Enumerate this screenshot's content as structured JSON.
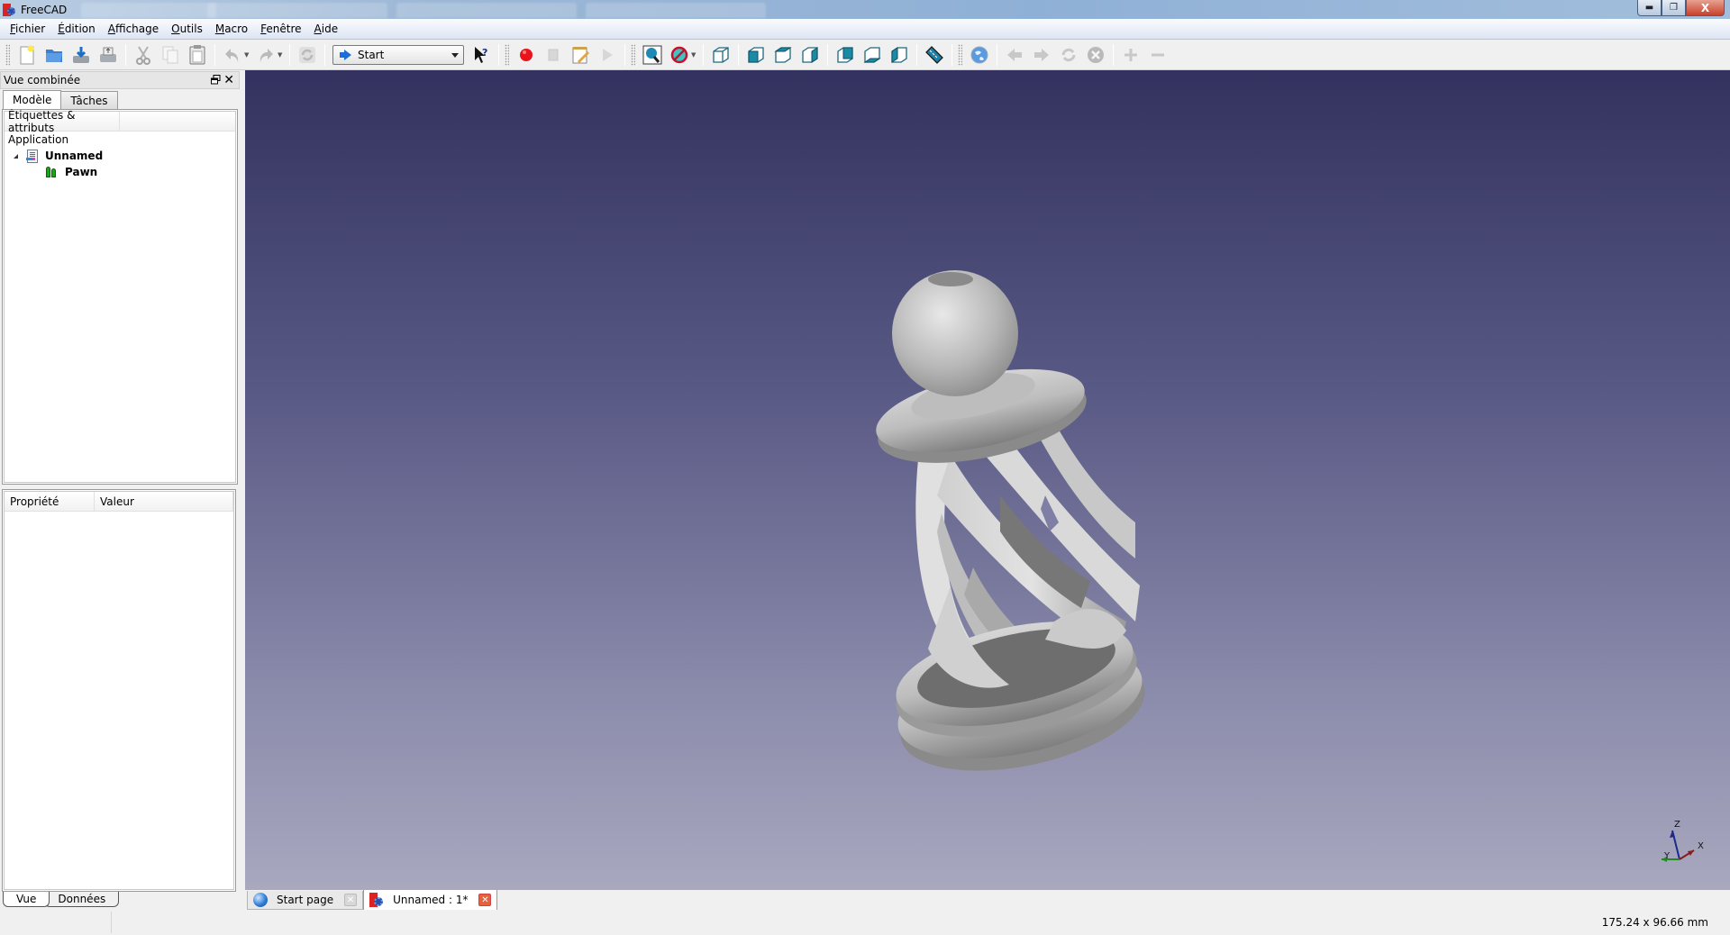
{
  "window": {
    "title": "FreeCAD",
    "controls": {
      "minimize": "—",
      "restore": "❐",
      "close": "X"
    }
  },
  "menubar": {
    "items": [
      {
        "label": "Fichier",
        "mnemonic": "F"
      },
      {
        "label": "Édition",
        "mnemonic": "É"
      },
      {
        "label": "Affichage",
        "mnemonic": "A"
      },
      {
        "label": "Outils",
        "mnemonic": "O"
      },
      {
        "label": "Macro",
        "mnemonic": "M"
      },
      {
        "label": "Fenêtre",
        "mnemonic": "F"
      },
      {
        "label": "Aide",
        "mnemonic": "A"
      }
    ]
  },
  "toolbar": {
    "file_tools": [
      {
        "icon": "new-document-icon",
        "enabled": true
      },
      {
        "icon": "open-folder-icon",
        "enabled": true
      },
      {
        "icon": "save-icon",
        "enabled": true
      },
      {
        "icon": "print-icon",
        "enabled": true
      }
    ],
    "edit_tools": [
      {
        "icon": "cut-icon",
        "enabled": false
      },
      {
        "icon": "copy-icon",
        "enabled": false
      },
      {
        "icon": "paste-icon",
        "enabled": true
      }
    ],
    "history_tools": [
      {
        "icon": "undo-icon",
        "enabled": false
      },
      {
        "icon": "redo-icon",
        "enabled": false
      },
      {
        "icon": "refresh-icon",
        "enabled": false
      }
    ],
    "workbench_selector": {
      "selected": "Start"
    },
    "whats_this_icon": "whats-this-icon",
    "macro_tools": [
      {
        "icon": "record-macro-icon",
        "enabled": true
      },
      {
        "icon": "stop-macro-icon",
        "enabled": false
      },
      {
        "icon": "edit-macro-icon",
        "enabled": true
      },
      {
        "icon": "run-macro-icon",
        "enabled": false
      }
    ],
    "view_tools": [
      {
        "icon": "fit-all-icon"
      },
      {
        "icon": "draw-style-icon"
      },
      {
        "icon": "isometric-view-icon"
      },
      {
        "icon": "front-view-icon"
      },
      {
        "icon": "top-view-icon"
      },
      {
        "icon": "right-view-icon"
      },
      {
        "icon": "rear-view-icon"
      },
      {
        "icon": "bottom-view-icon"
      },
      {
        "icon": "left-view-icon"
      },
      {
        "icon": "measure-distance-icon"
      }
    ],
    "web_tools": [
      {
        "icon": "web-globe-icon",
        "enabled": true
      },
      {
        "icon": "back-arrow-icon",
        "enabled": false
      },
      {
        "icon": "forward-arrow-icon",
        "enabled": false
      },
      {
        "icon": "web-refresh-icon",
        "enabled": false
      },
      {
        "icon": "web-stop-icon",
        "enabled": false
      },
      {
        "icon": "zoom-in-icon",
        "enabled": false
      },
      {
        "icon": "zoom-out-icon",
        "enabled": false
      }
    ]
  },
  "combo_view": {
    "title": "Vue combinée",
    "tabs": [
      {
        "label": "Modèle",
        "active": true
      },
      {
        "label": "Tâches",
        "active": false
      }
    ],
    "tree": {
      "header": "Étiquettes & attributs",
      "root": "Application",
      "document": "Unnamed",
      "objects": [
        {
          "label": "Pawn"
        }
      ]
    },
    "properties": {
      "columns": [
        "Propriété",
        "Valeur"
      ],
      "tabs": [
        {
          "label": "Vue",
          "active": true
        },
        {
          "label": "Données",
          "active": false
        }
      ]
    }
  },
  "viewport": {
    "gradient_top": "#33325f",
    "gradient_bottom": "#a8a8bf",
    "axis_labels": {
      "x": "X",
      "y": "Y",
      "z": "Z"
    },
    "axis_colors": {
      "x": "#8b1a1a",
      "y": "#1f8a1f",
      "z": "#1c2a8c"
    }
  },
  "document_tabs": [
    {
      "label": "Start page",
      "active": false
    },
    {
      "label": "Unnamed : 1*",
      "active": true
    }
  ],
  "statusbar": {
    "message": "",
    "dimensions": "175.24 x 96.66 mm"
  }
}
